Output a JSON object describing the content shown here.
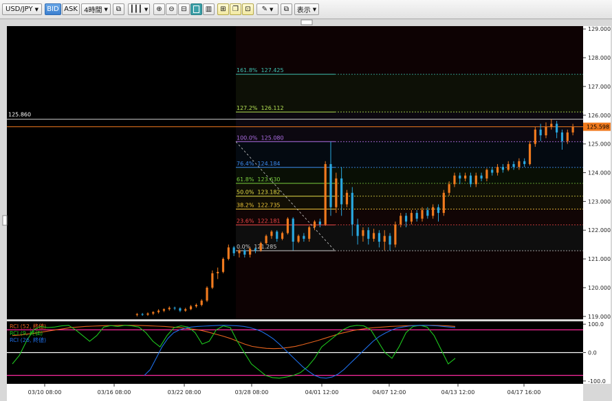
{
  "toolbar": {
    "symbol": "USD/JPY",
    "bid": "BID",
    "ask": "ASK",
    "timeframe": "4時間",
    "display": "表示",
    "icons": [
      "copy-icon",
      "bar-type-icon",
      "zoom-in-icon",
      "zoom-out-icon",
      "fit-icon",
      "panel-icon",
      "new-chart-icon",
      "window-icon",
      "save-icon",
      "pen-icon",
      "popout-icon"
    ]
  },
  "colors": {
    "bull": "#f07a1e",
    "bear": "#29a8e0",
    "current_line": "#f07a1e",
    "rci_short": "#1ec81e",
    "rci_mid": "#1e6ee8",
    "rci_long": "#e8641e",
    "rci_band": "#ff2aa0"
  },
  "chart_data": [
    {
      "type": "candlestick",
      "title": "USD/JPY 4時間",
      "y_ticks": [
        "129.000",
        "128.000",
        "127.000",
        "126.000",
        "125.000",
        "124.000",
        "123.000",
        "122.000",
        "121.000",
        "120.000",
        "119.000"
      ],
      "ylim": [
        118.9,
        129.1
      ],
      "x_ticks": [
        "03/10 08:00",
        "03/16 08:00",
        "03/22 08:00",
        "03/28 08:00",
        "04/01 12:00",
        "04/07 12:00",
        "04/13 12:00",
        "04/17 16:00"
      ],
      "current_price": "125.598",
      "high_marker": "125.860",
      "fibonacci": {
        "base_low": 121.285,
        "base_high": 125.08,
        "levels": [
          {
            "label": "161.8%",
            "value": 127.425,
            "value_text": "127.425",
            "color": "#3fc4b4"
          },
          {
            "label": "127.2%",
            "value": 126.112,
            "value_text": "126.112",
            "color": "#b4e054"
          },
          {
            "label": "100.0%",
            "value": 125.08,
            "value_text": "125.080",
            "color": "#b070e8"
          },
          {
            "label": "76.4%",
            "value": 124.184,
            "value_text": "124.184",
            "color": "#3c8cf0"
          },
          {
            "label": "61.8%",
            "value": 123.63,
            "value_text": "123.630",
            "color": "#7cd040"
          },
          {
            "label": "50.0%",
            "value": 123.182,
            "value_text": "123.182",
            "color": "#e8e048"
          },
          {
            "label": "38.2%",
            "value": 122.735,
            "value_text": "122.735",
            "color": "#f0c838"
          },
          {
            "label": "23.6%",
            "value": 122.181,
            "value_text": "122.181",
            "color": "#f04848"
          },
          {
            "label": "0.0%",
            "value": 121.285,
            "value_text": "121.285",
            "color": "#cccccc"
          }
        ]
      },
      "candles": [
        [
          119.05,
          119.08,
          119.0,
          119.12
        ],
        [
          119.08,
          119.06,
          119.02,
          119.12
        ],
        [
          119.06,
          119.1,
          119.02,
          119.14
        ],
        [
          119.1,
          119.15,
          119.05,
          119.18
        ],
        [
          119.15,
          119.2,
          119.1,
          119.25
        ],
        [
          119.2,
          119.25,
          119.15,
          119.28
        ],
        [
          119.25,
          119.3,
          119.2,
          119.35
        ],
        [
          119.3,
          119.28,
          119.22,
          119.34
        ],
        [
          119.28,
          119.2,
          119.15,
          119.32
        ],
        [
          119.2,
          119.25,
          119.16,
          119.3
        ],
        [
          119.25,
          119.35,
          119.22,
          119.4
        ],
        [
          119.35,
          119.4,
          119.3,
          119.45
        ],
        [
          119.4,
          119.55,
          119.35,
          119.6
        ],
        [
          119.55,
          120.0,
          119.5,
          120.05
        ],
        [
          120.0,
          120.5,
          119.95,
          120.6
        ],
        [
          120.5,
          120.55,
          120.3,
          120.7
        ],
        [
          120.55,
          121.0,
          120.5,
          121.05
        ],
        [
          121.0,
          121.4,
          120.95,
          121.5
        ],
        [
          121.4,
          121.2,
          121.1,
          121.45
        ],
        [
          121.2,
          121.3,
          121.05,
          121.35
        ],
        [
          121.3,
          121.15,
          121.05,
          121.35
        ],
        [
          121.15,
          121.35,
          121.05,
          121.4
        ],
        [
          121.35,
          121.3,
          121.2,
          121.4
        ],
        [
          121.3,
          121.55,
          121.25,
          121.6
        ],
        [
          121.55,
          121.8,
          121.5,
          121.85
        ],
        [
          121.8,
          121.95,
          121.7,
          122.0
        ],
        [
          121.95,
          121.7,
          121.6,
          122.0
        ],
        [
          121.7,
          121.9,
          121.65,
          121.95
        ],
        [
          121.9,
          122.4,
          121.85,
          122.45
        ],
        [
          122.4,
          121.6,
          121.3,
          122.45
        ],
        [
          121.6,
          121.8,
          121.55,
          121.85
        ],
        [
          121.8,
          121.7,
          121.6,
          121.9
        ],
        [
          121.7,
          122.1,
          121.6,
          122.15
        ],
        [
          122.1,
          122.3,
          122.0,
          122.35
        ],
        [
          122.3,
          122.2,
          122.1,
          122.4
        ],
        [
          122.2,
          124.3,
          122.15,
          124.4
        ],
        [
          124.3,
          122.8,
          122.5,
          125.08
        ],
        [
          122.8,
          123.8,
          122.6,
          124.0
        ],
        [
          123.8,
          122.9,
          122.5,
          124.2
        ],
        [
          122.9,
          123.3,
          122.8,
          123.4
        ],
        [
          123.3,
          122.2,
          121.8,
          123.5
        ],
        [
          122.2,
          121.8,
          121.5,
          122.4
        ],
        [
          121.8,
          122.0,
          121.6,
          122.1
        ],
        [
          122.0,
          121.7,
          121.5,
          122.1
        ],
        [
          121.7,
          121.9,
          121.6,
          122.05
        ],
        [
          121.9,
          121.6,
          121.4,
          122.0
        ],
        [
          121.6,
          121.8,
          121.3,
          122.0
        ],
        [
          121.8,
          121.5,
          121.29,
          121.9
        ],
        [
          121.5,
          122.2,
          121.4,
          122.3
        ],
        [
          122.2,
          122.5,
          122.1,
          122.6
        ],
        [
          122.5,
          122.3,
          122.1,
          122.6
        ],
        [
          122.3,
          122.6,
          122.2,
          122.7
        ],
        [
          122.6,
          122.4,
          122.3,
          122.7
        ],
        [
          122.4,
          122.7,
          122.3,
          122.8
        ],
        [
          122.7,
          122.5,
          122.4,
          122.8
        ],
        [
          122.5,
          122.8,
          122.4,
          122.9
        ],
        [
          122.8,
          122.6,
          122.3,
          122.9
        ],
        [
          122.6,
          123.3,
          122.5,
          123.4
        ],
        [
          123.3,
          123.6,
          123.2,
          123.7
        ],
        [
          123.6,
          123.9,
          123.5,
          124.0
        ],
        [
          123.9,
          123.8,
          123.6,
          124.0
        ],
        [
          123.8,
          123.9,
          123.7,
          124.0
        ],
        [
          123.9,
          123.6,
          123.5,
          124.0
        ],
        [
          123.6,
          123.9,
          123.5,
          124.0
        ],
        [
          123.9,
          123.8,
          123.7,
          124.0
        ],
        [
          123.8,
          124.1,
          123.7,
          124.15
        ],
        [
          124.1,
          124.0,
          123.9,
          124.2
        ],
        [
          124.0,
          124.2,
          123.9,
          124.3
        ],
        [
          124.2,
          124.1,
          124.0,
          124.3
        ],
        [
          124.1,
          124.3,
          124.05,
          124.4
        ],
        [
          124.3,
          124.2,
          124.1,
          124.4
        ],
        [
          124.2,
          124.4,
          124.1,
          124.5
        ],
        [
          124.4,
          124.3,
          124.2,
          124.5
        ],
        [
          124.3,
          125.0,
          124.25,
          125.1
        ],
        [
          125.0,
          125.5,
          124.9,
          125.6
        ],
        [
          125.5,
          125.3,
          125.1,
          125.7
        ],
        [
          125.3,
          125.6,
          125.2,
          125.75
        ],
        [
          125.6,
          125.7,
          125.5,
          125.86
        ],
        [
          125.7,
          125.4,
          125.2,
          125.8
        ],
        [
          125.4,
          125.1,
          124.8,
          125.5
        ],
        [
          125.1,
          125.4,
          125.0,
          125.5
        ],
        [
          125.4,
          125.6,
          125.3,
          125.7
        ]
      ],
      "candle_start_index": 37,
      "total_slots": 166
    },
    {
      "type": "line",
      "title": "RCI",
      "y_ticks": [
        "100.0",
        "0.0",
        "-100.0"
      ],
      "ylim": [
        -110,
        110
      ],
      "bands": [
        80,
        0,
        -80
      ],
      "series": [
        {
          "name": "RCI (52, 終値)",
          "color": "#e8641e",
          "values": [
            60,
            62,
            65,
            68,
            72,
            76,
            80,
            84,
            88,
            90,
            92,
            93,
            94,
            95,
            95,
            96,
            96,
            96,
            95,
            94,
            93,
            92,
            90,
            88,
            85,
            82,
            78,
            72,
            65,
            58,
            50,
            40,
            30,
            22,
            18,
            15,
            14,
            15,
            18,
            22,
            28,
            35,
            42,
            50,
            58,
            66,
            72,
            78,
            82,
            86,
            88,
            90,
            92,
            93,
            94,
            95,
            95,
            96,
            96,
            95,
            94,
            92
          ]
        },
        {
          "name": "RCI (9, 終価)",
          "color": "#1ec81e",
          "values": [
            -40,
            -10,
            40,
            80,
            92,
            88,
            90,
            94,
            96,
            80,
            60,
            40,
            60,
            90,
            95,
            92,
            96,
            94,
            90,
            70,
            40,
            20,
            60,
            88,
            94,
            90,
            70,
            30,
            40,
            80,
            94,
            88,
            40,
            0,
            -40,
            -60,
            -80,
            -88,
            -90,
            -86,
            -80,
            -70,
            -50,
            -20,
            20,
            40,
            60,
            80,
            92,
            96,
            94,
            80,
            40,
            0,
            -20,
            20,
            70,
            92,
            96,
            90,
            60,
            10,
            -40,
            -20
          ]
        },
        {
          "name": "RCI (26, 終値)",
          "color": "#1e6ee8",
          "values": [
            -80,
            -60,
            -20,
            20,
            50,
            70,
            80,
            86,
            90,
            92,
            93,
            94,
            95,
            96,
            96,
            95,
            94,
            92,
            88,
            82,
            74,
            62,
            48,
            30,
            10,
            -10,
            -30,
            -50,
            -66,
            -80,
            -88,
            -90,
            -86,
            -76,
            -60,
            -40,
            -20,
            0,
            20,
            40,
            56,
            68,
            78,
            86,
            90,
            93,
            95,
            96,
            96,
            95,
            94,
            92,
            90,
            88
          ]
        }
      ]
    }
  ]
}
